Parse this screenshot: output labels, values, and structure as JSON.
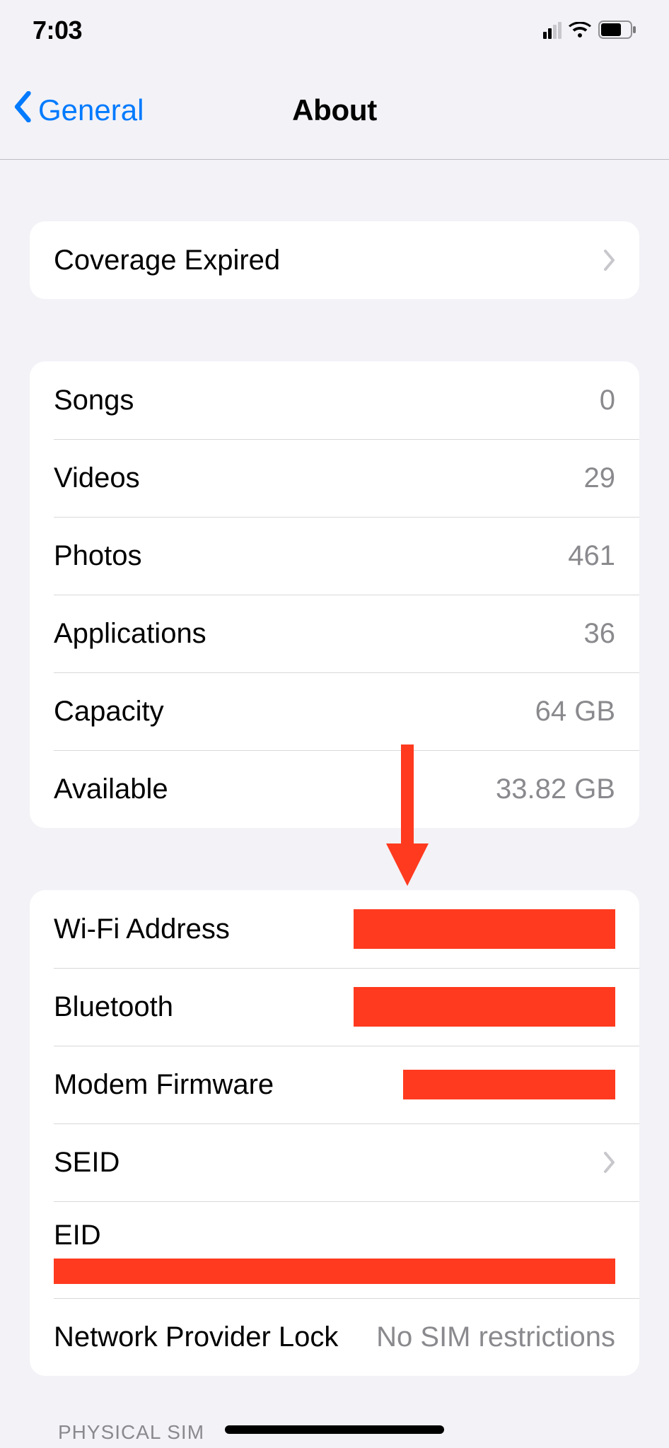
{
  "status": {
    "time": "7:03"
  },
  "nav": {
    "back_label": "General",
    "title": "About"
  },
  "group_coverage": {
    "coverage_label": "Coverage Expired"
  },
  "group_counts": {
    "songs_label": "Songs",
    "songs_value": "0",
    "videos_label": "Videos",
    "videos_value": "29",
    "photos_label": "Photos",
    "photos_value": "461",
    "apps_label": "Applications",
    "apps_value": "36",
    "capacity_label": "Capacity",
    "capacity_value": "64 GB",
    "available_label": "Available",
    "available_value": "33.82 GB"
  },
  "group_net": {
    "wifi_label": "Wi-Fi Address",
    "bt_label": "Bluetooth",
    "modem_label": "Modem Firmware",
    "seid_label": "SEID",
    "eid_label": "EID",
    "npl_label": "Network Provider Lock",
    "npl_value": "No SIM restrictions"
  },
  "footer": {
    "section_label": "PHYSICAL SIM"
  }
}
